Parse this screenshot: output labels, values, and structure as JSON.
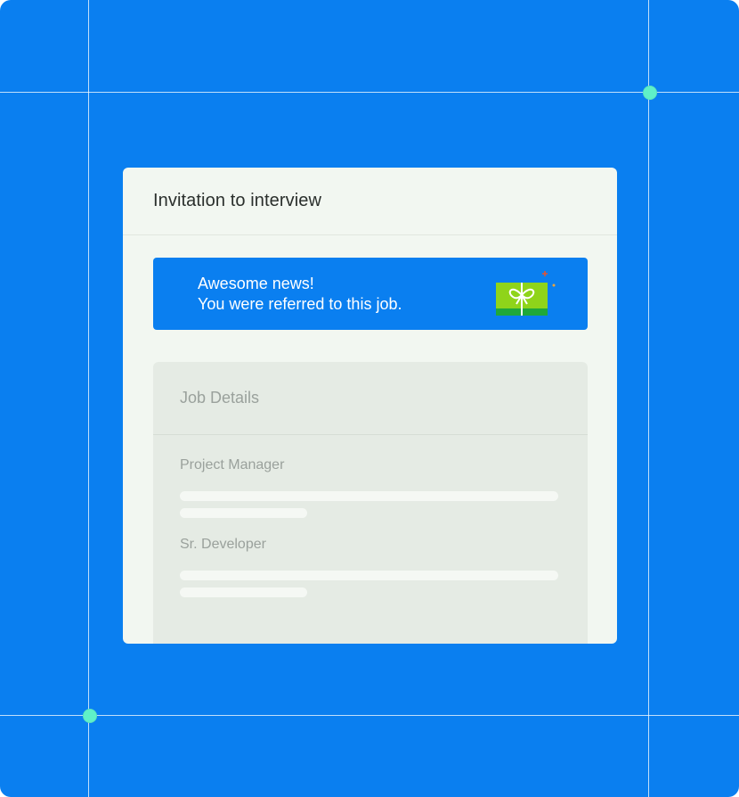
{
  "card": {
    "title": "Invitation to interview"
  },
  "banner": {
    "line1": "Awesome news!",
    "line2": "You were referred to this job.",
    "icon": "gift-icon"
  },
  "job_details": {
    "title": "Job Details",
    "jobs": [
      {
        "name": "Project Manager"
      },
      {
        "name": "Sr. Developer"
      }
    ]
  },
  "colors": {
    "background": "#0a7ff0",
    "card": "#f2f7f1",
    "banner": "#0a7ff0",
    "handle": "#5ff0c8",
    "gift_green": "#8fd41a",
    "gift_dark_green": "#1fa83a"
  }
}
